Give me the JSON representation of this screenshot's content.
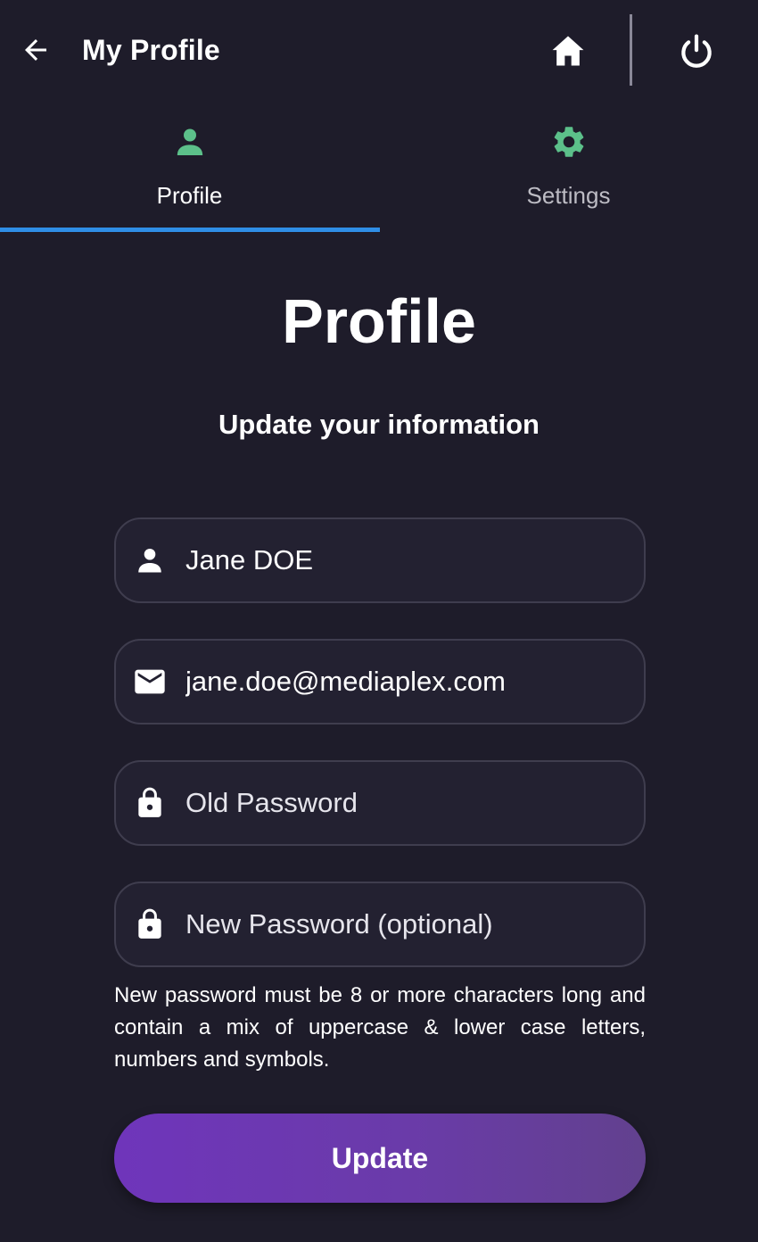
{
  "header": {
    "title": "My Profile",
    "back_icon": "arrow-left-icon",
    "home_icon": "home-icon",
    "power_icon": "power-icon"
  },
  "tabs": [
    {
      "label": "Profile",
      "icon": "person-icon",
      "selected": true
    },
    {
      "label": "Settings",
      "icon": "gear-icon",
      "selected": false
    }
  ],
  "main": {
    "title": "Profile",
    "subtitle": "Update your information",
    "fields": {
      "name": {
        "value": "Jane DOE",
        "icon": "person-icon"
      },
      "email": {
        "value": "jane.doe@mediaplex.com",
        "icon": "mail-icon"
      },
      "old_password": {
        "value": "",
        "placeholder": "Old Password",
        "icon": "lock-icon"
      },
      "new_password": {
        "value": "",
        "placeholder": "New Password (optional)",
        "icon": "lock-icon"
      }
    },
    "password_hint": "New password must be 8 or more characters long and contain a mix of uppercase & lower case letters, numbers and symbols.",
    "update_label": "Update"
  },
  "colors": {
    "background": "#1e1c2a",
    "tab_icon_accent": "#5cc08a",
    "tab_indicator": "#2f8ee6",
    "button_gradient_start": "#6f35bb",
    "button_gradient_end": "#62418e"
  }
}
